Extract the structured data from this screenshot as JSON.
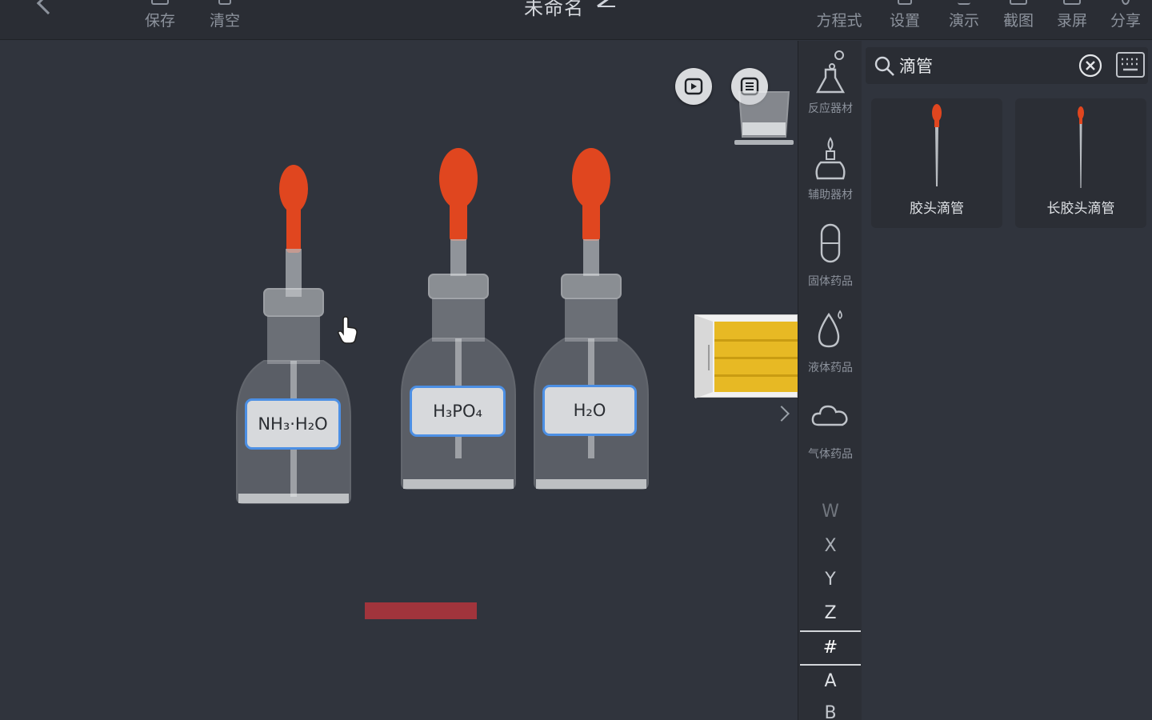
{
  "topbar": {
    "save_label": "保存",
    "clear_label": "清空",
    "title": "未命名",
    "equation_label": "方程式",
    "settings_label": "设置",
    "demo_label": "演示",
    "screenshot_label": "截图",
    "record_label": "录屏",
    "share_label": "分享"
  },
  "canvas": {
    "bottles": [
      {
        "label": "NH₃·H₂O"
      },
      {
        "label": "H₃PO₄"
      },
      {
        "label": "H₂O"
      }
    ]
  },
  "categories": [
    {
      "label": "反应器材",
      "icon": "flask-icon"
    },
    {
      "label": "辅助器材",
      "icon": "alcohol-lamp-icon"
    },
    {
      "label": "固体药品",
      "icon": "capsule-icon"
    },
    {
      "label": "液体药品",
      "icon": "droplet-icon"
    },
    {
      "label": "气体药品",
      "icon": "cloud-icon"
    }
  ],
  "alphabet": [
    "W",
    "X",
    "Y",
    "Z",
    "#",
    "A",
    "B"
  ],
  "search": {
    "value": "滴管"
  },
  "results": [
    {
      "name": "胶头滴管"
    },
    {
      "name": "长胶头滴管"
    }
  ],
  "colors": {
    "accent_blue": "#4c8fe4",
    "dropper_red": "#e0461f",
    "panel_bg": "#30343d"
  }
}
